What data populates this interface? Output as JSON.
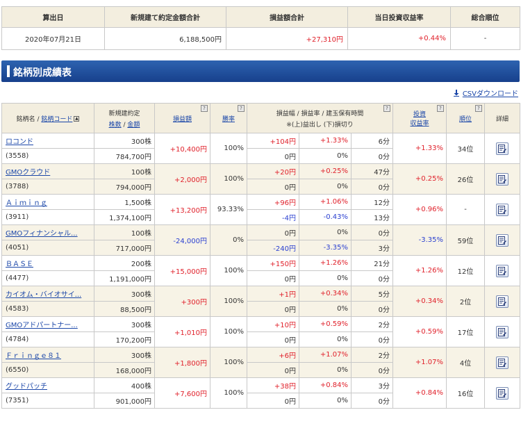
{
  "summary": {
    "headers": [
      "算出日",
      "新規建て約定金額合計",
      "損益額合計",
      "当日投資収益率",
      "総合順位"
    ],
    "date": "2020年07月21日",
    "total_amount": "6,188,500円",
    "total_pnl": "+27,310円",
    "return_rate": "+0.44%",
    "rank": "-"
  },
  "title": "銘柄別成績表",
  "csv_label": "CSVダウンロード",
  "header": {
    "name": "銘柄名",
    "slash": " / ",
    "code": "銘柄コード",
    "sort_icon": "▲",
    "contract": "新規建約定",
    "shares": "株数",
    "amount": "金額",
    "pnl": "損益額",
    "winrate": "勝率",
    "range_line1": "損益幅 / 損益率 / 建玉保有時間",
    "range_line2": "※(上)益出し (下)損切り",
    "return_line1": "投資",
    "return_line2": "収益率",
    "rank": "順位",
    "detail": "詳細",
    "q": "?"
  },
  "colors": {
    "plus": "#e0202a",
    "minus": "#2a3fd0",
    "title_bar": "#1f4f9e"
  },
  "rows": [
    {
      "name": "ロコンド",
      "code": "(3558)",
      "shares": "300株",
      "amount": "784,700円",
      "pnl": "+10,400円",
      "pnl_sign": "plus",
      "winrate": "100%",
      "up_width": "+104円",
      "up_width_sign": "plus",
      "up_rate": "+1.33%",
      "up_rate_sign": "plus",
      "up_time": "6分",
      "dn_width": "0円",
      "dn_width_sign": "",
      "dn_rate": "0%",
      "dn_rate_sign": "",
      "dn_time": "0分",
      "ret": "+1.33%",
      "ret_sign": "plus",
      "rank": "34位"
    },
    {
      "name": "GMOクラウド",
      "code": "(3788)",
      "shares": "100株",
      "amount": "794,000円",
      "pnl": "+2,000円",
      "pnl_sign": "plus",
      "winrate": "100%",
      "up_width": "+20円",
      "up_width_sign": "plus",
      "up_rate": "+0.25%",
      "up_rate_sign": "plus",
      "up_time": "47分",
      "dn_width": "0円",
      "dn_width_sign": "",
      "dn_rate": "0%",
      "dn_rate_sign": "",
      "dn_time": "0分",
      "ret": "+0.25%",
      "ret_sign": "plus",
      "rank": "26位"
    },
    {
      "name": "Ａｉｍｉｎｇ",
      "code": "(3911)",
      "shares": "1,500株",
      "amount": "1,374,100円",
      "pnl": "+13,200円",
      "pnl_sign": "plus",
      "winrate": "93.33%",
      "up_width": "+96円",
      "up_width_sign": "plus",
      "up_rate": "+1.06%",
      "up_rate_sign": "plus",
      "up_time": "12分",
      "dn_width": "-4円",
      "dn_width_sign": "minus",
      "dn_rate": "-0.43%",
      "dn_rate_sign": "minus",
      "dn_time": "13分",
      "ret": "+0.96%",
      "ret_sign": "plus",
      "rank": "-"
    },
    {
      "name": "GMOフィナンシャル...",
      "code": "(4051)",
      "shares": "100株",
      "amount": "717,000円",
      "pnl": "-24,000円",
      "pnl_sign": "minus",
      "winrate": "0%",
      "up_width": "0円",
      "up_width_sign": "",
      "up_rate": "0%",
      "up_rate_sign": "",
      "up_time": "0分",
      "dn_width": "-240円",
      "dn_width_sign": "minus",
      "dn_rate": "-3.35%",
      "dn_rate_sign": "minus",
      "dn_time": "3分",
      "ret": "-3.35%",
      "ret_sign": "minus",
      "rank": "59位"
    },
    {
      "name": "ＢＡＳＥ",
      "code": "(4477)",
      "shares": "200株",
      "amount": "1,191,000円",
      "pnl": "+15,000円",
      "pnl_sign": "plus",
      "winrate": "100%",
      "up_width": "+150円",
      "up_width_sign": "plus",
      "up_rate": "+1.26%",
      "up_rate_sign": "plus",
      "up_time": "21分",
      "dn_width": "0円",
      "dn_width_sign": "",
      "dn_rate": "0%",
      "dn_rate_sign": "",
      "dn_time": "0分",
      "ret": "+1.26%",
      "ret_sign": "plus",
      "rank": "12位"
    },
    {
      "name": "カイオム・バイオサイ...",
      "code": "(4583)",
      "shares": "300株",
      "amount": "88,500円",
      "pnl": "+300円",
      "pnl_sign": "plus",
      "winrate": "100%",
      "up_width": "+1円",
      "up_width_sign": "plus",
      "up_rate": "+0.34%",
      "up_rate_sign": "plus",
      "up_time": "5分",
      "dn_width": "0円",
      "dn_width_sign": "",
      "dn_rate": "0%",
      "dn_rate_sign": "",
      "dn_time": "0分",
      "ret": "+0.34%",
      "ret_sign": "plus",
      "rank": "2位"
    },
    {
      "name": "GMOアドパートナー...",
      "code": "(4784)",
      "shares": "300株",
      "amount": "170,200円",
      "pnl": "+1,010円",
      "pnl_sign": "plus",
      "winrate": "100%",
      "up_width": "+10円",
      "up_width_sign": "plus",
      "up_rate": "+0.59%",
      "up_rate_sign": "plus",
      "up_time": "2分",
      "dn_width": "0円",
      "dn_width_sign": "",
      "dn_rate": "0%",
      "dn_rate_sign": "",
      "dn_time": "0分",
      "ret": "+0.59%",
      "ret_sign": "plus",
      "rank": "17位"
    },
    {
      "name": "Ｆｒｉｎｇｅ８１",
      "code": "(6550)",
      "shares": "300株",
      "amount": "168,000円",
      "pnl": "+1,800円",
      "pnl_sign": "plus",
      "winrate": "100%",
      "up_width": "+6円",
      "up_width_sign": "plus",
      "up_rate": "+1.07%",
      "up_rate_sign": "plus",
      "up_time": "2分",
      "dn_width": "0円",
      "dn_width_sign": "",
      "dn_rate": "0%",
      "dn_rate_sign": "",
      "dn_time": "0分",
      "ret": "+1.07%",
      "ret_sign": "plus",
      "rank": "4位"
    },
    {
      "name": "グッドパッチ",
      "code": "(7351)",
      "shares": "400株",
      "amount": "901,000円",
      "pnl": "+7,600円",
      "pnl_sign": "plus",
      "winrate": "100%",
      "up_width": "+38円",
      "up_width_sign": "plus",
      "up_rate": "+0.84%",
      "up_rate_sign": "plus",
      "up_time": "3分",
      "dn_width": "0円",
      "dn_width_sign": "",
      "dn_rate": "0%",
      "dn_rate_sign": "",
      "dn_time": "0分",
      "ret": "+0.84%",
      "ret_sign": "plus",
      "rank": "16位"
    }
  ]
}
